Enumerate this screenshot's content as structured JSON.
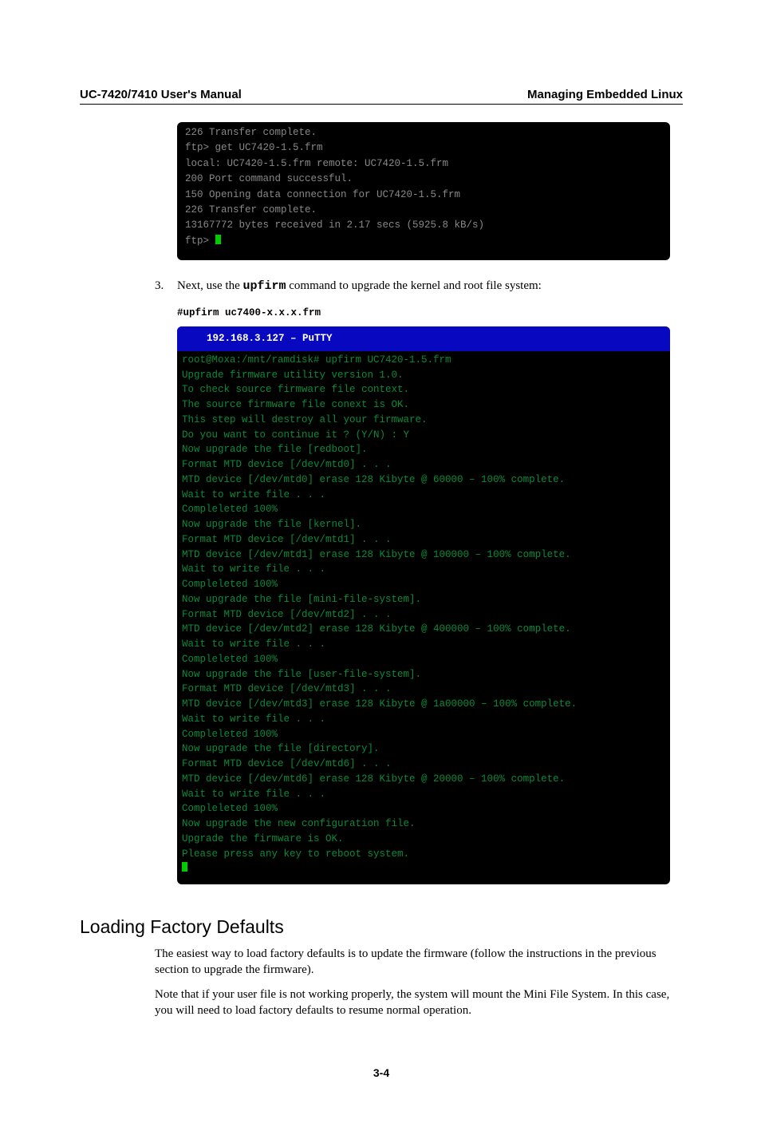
{
  "header": {
    "left": "UC-7420/7410 User's Manual",
    "right": "Managing Embedded Linux"
  },
  "terminal1": {
    "lines": "226 Transfer complete.\nftp> get UC7420-1.5.frm\nlocal: UC7420-1.5.frm remote: UC7420-1.5.frm\n200 Port command successful.\n150 Opening data connection for UC7420-1.5.frm\n226 Transfer complete.\n13167772 bytes received in 2.17 secs (5925.8 kB/s)\nftp> "
  },
  "step3": {
    "number": "3.",
    "text_before": "Next, use the ",
    "code": "upfirm",
    "text_after": " command to upgrade the kernel and root file system:"
  },
  "cmd": "#upfirm uc7400-x.x.x.frm",
  "terminal2": {
    "title": "  192.168.3.127 – PuTTY",
    "body": "root@Moxa:/mnt/ramdisk# upfirm UC7420-1.5.frm\nUpgrade firmware utility version 1.0.\nTo check source firmware file context.\nThe source firmware file conext is OK.\nThis step will destroy all your firmware.\nDo you want to continue it ? (Y/N) : Y\nNow upgrade the file [redboot].\nFormat MTD device [/dev/mtd0] . . .\nMTD device [/dev/mtd0] erase 128 Kibyte @ 60000 – 100% complete.\nWait to write file . . .\nCompleleted 100%\nNow upgrade the file [kernel].\nFormat MTD device [/dev/mtd1] . . .\nMTD device [/dev/mtd1] erase 128 Kibyte @ 100000 – 100% complete.\nWait to write file . . .\nCompleleted 100%\nNow upgrade the file [mini-file-system].\nFormat MTD device [/dev/mtd2] . . .\nMTD device [/dev/mtd2] erase 128 Kibyte @ 400000 – 100% complete.\nWait to write file . . .\nCompleleted 100%\nNow upgrade the file [user-file-system].\nFormat MTD device [/dev/mtd3] . . .\nMTD device [/dev/mtd3] erase 128 Kibyte @ 1a00000 – 100% complete.\nWait to write file . . .\nCompleleted 100%\nNow upgrade the file [directory].\nFormat MTD device [/dev/mtd6] . . .\nMTD device [/dev/mtd6] erase 128 Kibyte @ 20000 – 100% complete.\nWait to write file . . .\nCompleleted 100%\nNow upgrade the new configuration file.\nUpgrade the firmware is OK.\nPlease press any key to reboot system."
  },
  "section_heading": "Loading Factory Defaults",
  "para1": "The easiest way to load factory defaults is to update the firmware (follow the instructions in the previous section to upgrade the firmware).",
  "para2": "Note that if your user file is not working properly, the system will mount the Mini File System. In this case, you will need to load factory defaults to resume normal operation.",
  "page_number": "3-4"
}
